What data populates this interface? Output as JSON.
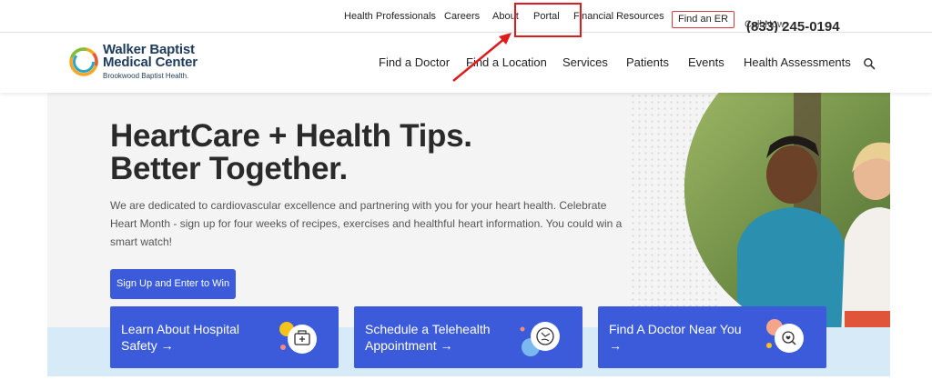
{
  "utility": {
    "links": [
      "Health Professionals",
      "Careers",
      "About",
      "Portal",
      "Financial Resources"
    ],
    "find_er": "Find an ER",
    "call_label": "Call Now",
    "call_number": "(833) 245-0194"
  },
  "logo": {
    "line1": "Walker Baptist",
    "line2": "Medical Center",
    "line3": "Brookwood Baptist Health."
  },
  "nav": {
    "items": [
      "Find a Doctor",
      "Find a Location",
      "Services",
      "Patients",
      "Events",
      "Health Assessments"
    ],
    "search_icon": "search-icon"
  },
  "hero": {
    "title_line1": "HeartCare + Health Tips.",
    "title_line2": "Better Together.",
    "intro": "We are dedicated to cardiovascular excellence and partnering with you for your heart health. Celebrate Heart Month - sign up for four weeks of recipes, exercises and healthful heart information. You could win a smart watch!",
    "cta": "Sign Up and Enter to Win"
  },
  "cards": [
    {
      "line1": "Learn About Hospital",
      "line2": "Safety →",
      "icon": "first-aid-kit-icon"
    },
    {
      "line1": "Schedule a Telehealth",
      "line2": "Appointment →",
      "icon": "telehealth-icon"
    },
    {
      "line1": "Find A Doctor Near You",
      "line2": "→",
      "icon": "doctor-search-icon"
    }
  ],
  "colors": {
    "brand_blue": "#3b5bdb",
    "annotation_red": "#e01b1b",
    "navy": "#1f3b5c",
    "hero_bg": "#f4f4f5",
    "strip_bg": "#d6ebf7"
  }
}
